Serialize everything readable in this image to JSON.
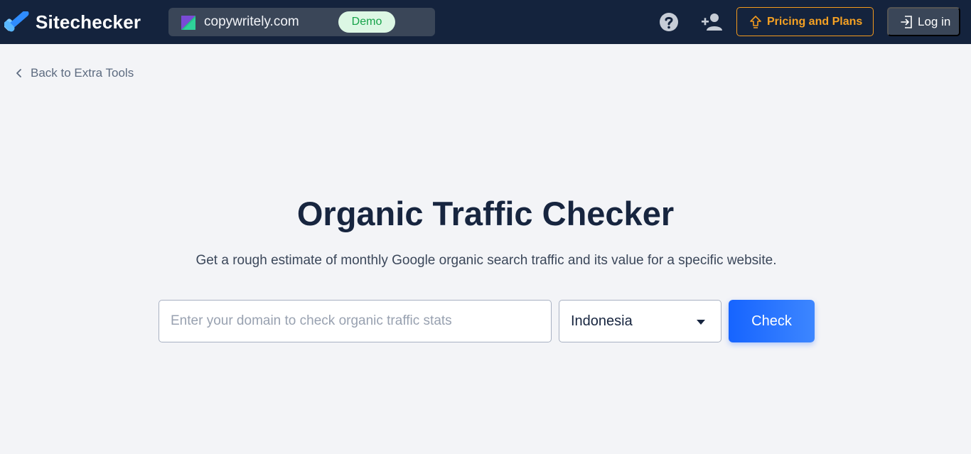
{
  "header": {
    "brand": "Sitechecker",
    "project": {
      "domain": "copywritely.com",
      "badge": "Demo"
    },
    "pricing_label": "Pricing and Plans",
    "login_label": "Log in",
    "icons": [
      "check-logo-icon",
      "help-icon",
      "add-user-icon",
      "upgrade-arrow-icon",
      "login-icon"
    ]
  },
  "nav": {
    "back_label": "Back to Extra Tools"
  },
  "main": {
    "title": "Organic Traffic Checker",
    "subtitle": "Get a rough estimate of monthly Google organic search traffic and its value for a specific website.",
    "domain_placeholder": "Enter your domain to check organic traffic stats",
    "domain_value": "",
    "country": "Indonesia",
    "check_label": "Check"
  },
  "colors": {
    "header_bg": "#14233d",
    "page_bg": "#f3f4f7",
    "accent_blue": "#1664ff",
    "pricing_orange": "#f39a1d",
    "demo_green": "#17a34a"
  }
}
